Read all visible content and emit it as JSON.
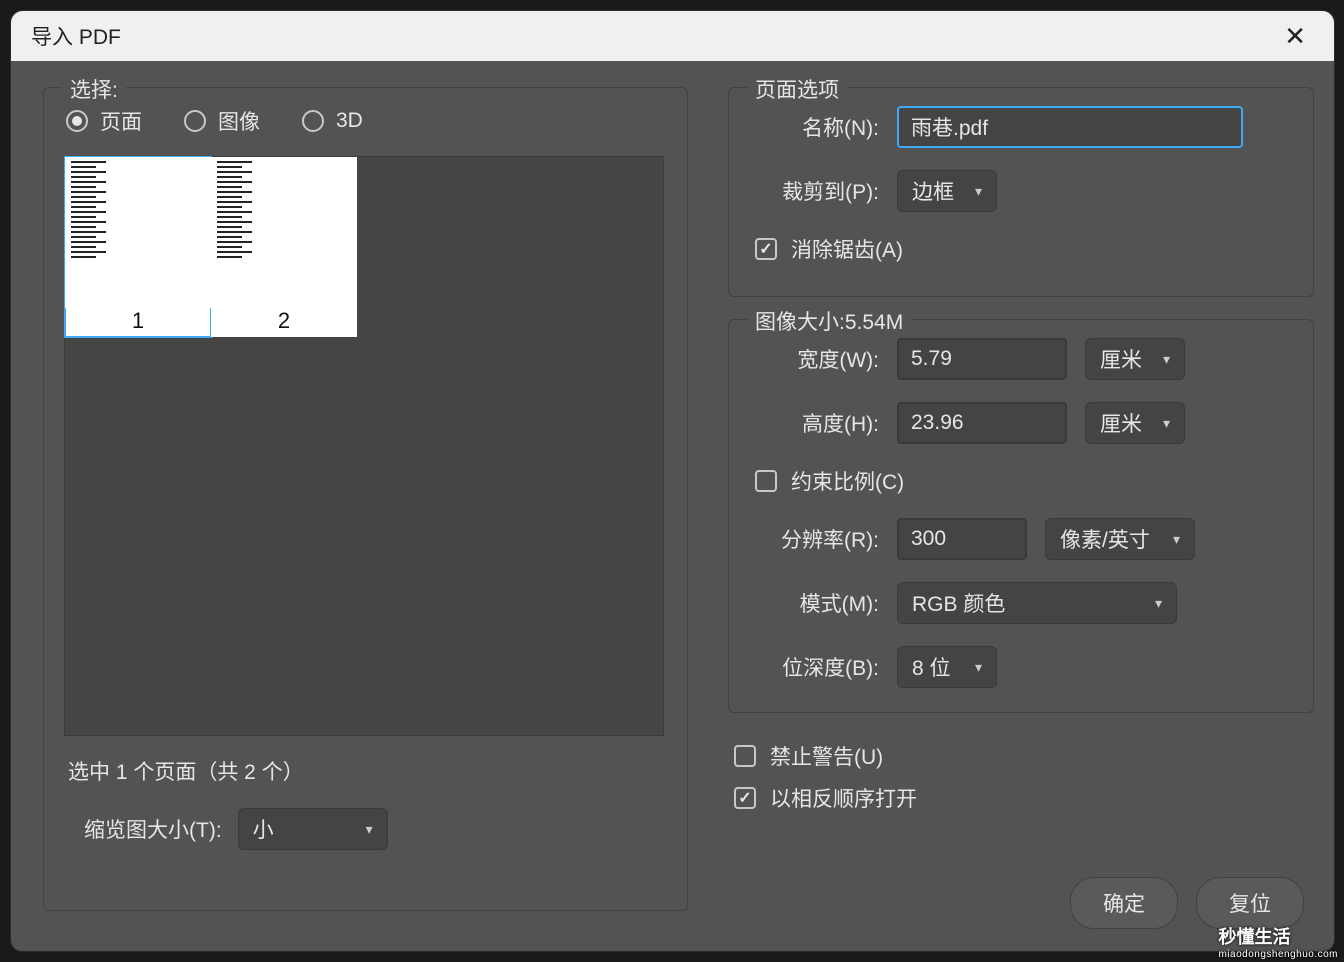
{
  "title": "导入 PDF",
  "select_group": {
    "legend": "选择:",
    "radios": {
      "page": "页面",
      "image": "图像",
      "threeD": "3D"
    },
    "thumbs": [
      {
        "num": "1",
        "selected": true
      },
      {
        "num": "2",
        "selected": false
      }
    ],
    "status": "选中 1 个页面（共 2 个）",
    "thumb_size_label": "缩览图大小(T):",
    "thumb_size_value": "小"
  },
  "page_options": {
    "legend": "页面选项",
    "name_label": "名称(N):",
    "name_value": "雨巷.pdf",
    "crop_label": "裁剪到(P):",
    "crop_value": "边框",
    "antialias_label": "消除锯齿(A)"
  },
  "image_size": {
    "legend": "图像大小:5.54M",
    "width_label": "宽度(W):",
    "width_value": "5.79",
    "width_unit": "厘米",
    "height_label": "高度(H):",
    "height_value": "23.96",
    "height_unit": "厘米",
    "constrain_label": "约束比例(C)",
    "res_label": "分辨率(R):",
    "res_value": "300",
    "res_unit": "像素/英寸",
    "mode_label": "模式(M):",
    "mode_value": "RGB 颜色",
    "depth_label": "位深度(B):",
    "depth_value": "8 位"
  },
  "suppress_warnings_label": "禁止警告(U)",
  "reverse_order_label": "以相反顺序打开",
  "buttons": {
    "ok": "确定",
    "reset": "复位"
  },
  "watermark": {
    "big": "秒懂生活",
    "small": "miaodongshenghuo.com"
  }
}
